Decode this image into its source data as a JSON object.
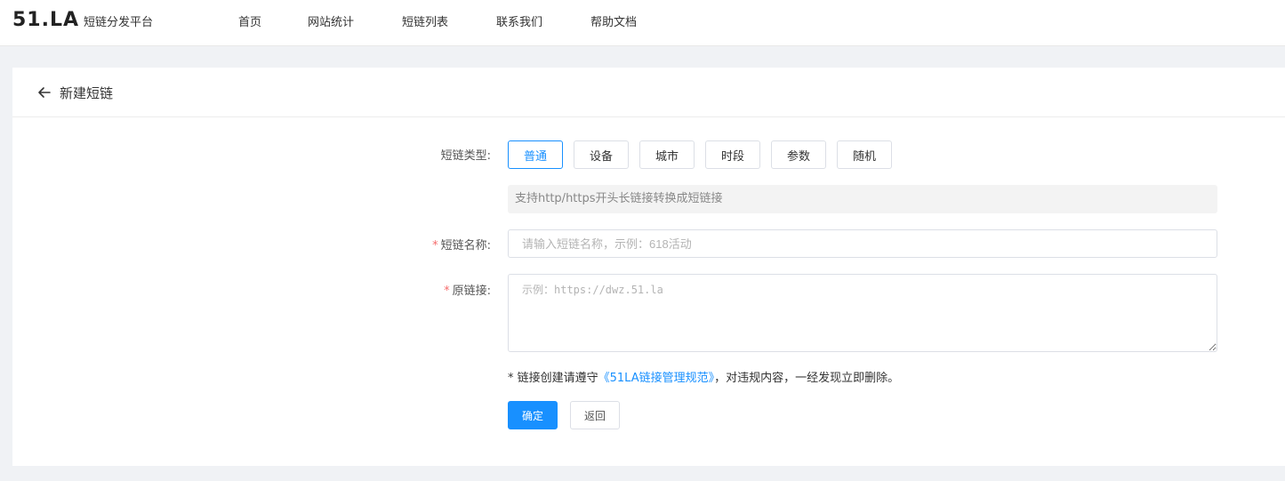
{
  "header": {
    "logo_text": "51.LA",
    "platform_name": "短链分发平台",
    "nav": [
      {
        "label": "首页"
      },
      {
        "label": "网站统计"
      },
      {
        "label": "短链列表"
      },
      {
        "label": "联系我们"
      },
      {
        "label": "帮助文档"
      }
    ]
  },
  "page": {
    "title": "新建短链",
    "back_icon": "arrow-left-icon"
  },
  "form": {
    "type_label": "短链类型:",
    "types": [
      {
        "label": "普通",
        "active": true
      },
      {
        "label": "设备",
        "active": false
      },
      {
        "label": "城市",
        "active": false
      },
      {
        "label": "时段",
        "active": false
      },
      {
        "label": "参数",
        "active": false
      },
      {
        "label": "随机",
        "active": false
      }
    ],
    "type_hint": "支持http/https开头长链接转换成短链接",
    "name_required": "*",
    "name_label": "短链名称:",
    "name_placeholder": "请输入短链名称，示例：618活动",
    "url_required": "*",
    "url_label": "原链接:",
    "url_placeholder": "示例：https://dwz.51.la",
    "notice_prefix": "* 链接创建请遵守",
    "notice_link": "《51LA链接管理规范》",
    "notice_suffix": "，对违规内容，一经发现立即删除。",
    "confirm_label": "确定",
    "back_label": "返回"
  },
  "colors": {
    "accent": "#1890ff",
    "required": "#f56c6c",
    "background": "#f0f2f5"
  }
}
